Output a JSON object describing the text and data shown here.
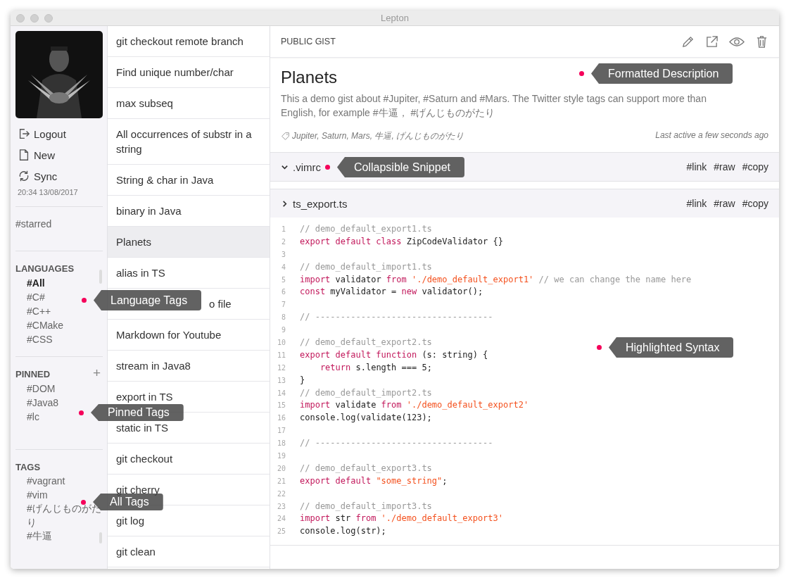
{
  "window": {
    "title": "Lepton"
  },
  "sidebar": {
    "actions": [
      {
        "kind": "logout",
        "label": "Logout"
      },
      {
        "kind": "new",
        "label": "New"
      },
      {
        "kind": "sync",
        "label": "Sync"
      }
    ],
    "sync_time": "20:34 13/08/2017",
    "starred": "#starred",
    "languages": {
      "heading": "LANGUAGES",
      "items": [
        {
          "label": "#All",
          "selected": true
        },
        {
          "label": "#C#",
          "selected": false
        },
        {
          "label": "#C++",
          "selected": false
        },
        {
          "label": "#CMake",
          "selected": false
        },
        {
          "label": "#CSS",
          "selected": false
        }
      ]
    },
    "pinned": {
      "heading": "PINNED",
      "add": "+",
      "items": [
        "#DOM",
        "#Java8",
        "#lc"
      ]
    },
    "tags": {
      "heading": "TAGS",
      "items": [
        "#vagrant",
        "#vim",
        "#げんじものがたり",
        "#牛逼"
      ]
    }
  },
  "gists": [
    {
      "title": "git checkout remote branch",
      "selected": false,
      "covered": false
    },
    {
      "title": "Find unique number/char",
      "selected": false,
      "covered": false
    },
    {
      "title": "max subseq",
      "selected": false,
      "covered": false
    },
    {
      "title": "All occurrences of substr in a string",
      "selected": false,
      "covered": false
    },
    {
      "title": "String & char in Java",
      "selected": false,
      "covered": false
    },
    {
      "title": "binary in Java",
      "selected": false,
      "covered": false
    },
    {
      "title": "Planets",
      "selected": true,
      "covered": false
    },
    {
      "title": "alias in TS",
      "selected": false,
      "covered": false
    },
    {
      "title": "o file",
      "selected": false,
      "covered": true
    },
    {
      "title": "Markdown for Youtube",
      "selected": false,
      "covered": false
    },
    {
      "title": "stream in Java8",
      "selected": false,
      "covered": false
    },
    {
      "title": "export in TS",
      "selected": false,
      "covered": false
    },
    {
      "title": "static in TS",
      "selected": false,
      "covered": false
    },
    {
      "title": "git checkout",
      "selected": false,
      "covered": false
    },
    {
      "title": "git cherry",
      "selected": false,
      "covered": false
    },
    {
      "title": "git log",
      "selected": false,
      "covered": false
    },
    {
      "title": "git clean",
      "selected": false,
      "covered": false
    }
  ],
  "detail": {
    "visibility": "PUBLIC GIST",
    "title": "Planets",
    "description": "This a demo gist about #Jupiter, #Saturn and #Mars. The Twitter style tags can support more than English, for example #牛逼，  #げんじものがたり",
    "tags": "Jupiter, Saturn, Mars, 牛逼, げんじものがたり",
    "last_active": "Last active a few seconds ago",
    "snippets": [
      {
        "name": ".vimrc",
        "expanded": true,
        "actions": [
          "#link",
          "#raw",
          "#copy"
        ]
      },
      {
        "name": "ts_export.ts",
        "expanded": false,
        "actions": [
          "#link",
          "#raw",
          "#copy"
        ],
        "code": [
          {
            "n": "1",
            "tokens": [
              {
                "kind": "comment",
                "text": "// demo_default_export1.ts"
              }
            ]
          },
          {
            "n": "2",
            "tokens": [
              {
                "kind": "keyword",
                "text": "export default class "
              },
              {
                "kind": "plain",
                "text": "ZipCodeValidator {}"
              }
            ]
          },
          {
            "n": "3"
          },
          {
            "n": "4",
            "tokens": [
              {
                "kind": "comment",
                "text": "// demo_default_import1.ts"
              }
            ]
          },
          {
            "n": "5",
            "tokens": [
              {
                "kind": "keyword",
                "text": "import "
              },
              {
                "kind": "plain",
                "text": "validator "
              },
              {
                "kind": "keyword",
                "text": "from "
              },
              {
                "kind": "string",
                "text": "'./demo_default_export1'"
              },
              {
                "kind": "comment",
                "text": " // we can change the name here"
              }
            ]
          },
          {
            "n": "6",
            "tokens": [
              {
                "kind": "keyword",
                "text": "const "
              },
              {
                "kind": "plain",
                "text": "myValidator = "
              },
              {
                "kind": "keyword",
                "text": "new "
              },
              {
                "kind": "plain",
                "text": "validator();"
              }
            ]
          },
          {
            "n": "7"
          },
          {
            "n": "8",
            "tokens": [
              {
                "kind": "comment",
                "text": "// -----------------------------------"
              }
            ]
          },
          {
            "n": "9"
          },
          {
            "n": "10",
            "tokens": [
              {
                "kind": "comment",
                "text": "// demo_default_export2.ts"
              }
            ]
          },
          {
            "n": "11",
            "tokens": [
              {
                "kind": "keyword",
                "text": "export default function "
              },
              {
                "kind": "plain",
                "text": "(s: string) {"
              }
            ]
          },
          {
            "n": "12",
            "tokens": [
              {
                "kind": "keyword",
                "text": "    return "
              },
              {
                "kind": "plain",
                "text": "s.length === 5;"
              }
            ]
          },
          {
            "n": "13",
            "tokens": [
              {
                "kind": "plain",
                "text": "}"
              }
            ]
          },
          {
            "n": "14",
            "tokens": [
              {
                "kind": "comment",
                "text": "// demo_default_import2.ts"
              }
            ]
          },
          {
            "n": "15",
            "tokens": [
              {
                "kind": "keyword",
                "text": "import "
              },
              {
                "kind": "plain",
                "text": "validate "
              },
              {
                "kind": "keyword",
                "text": "from "
              },
              {
                "kind": "string",
                "text": "'./demo_default_export2'"
              }
            ]
          },
          {
            "n": "16",
            "tokens": [
              {
                "kind": "plain",
                "text": "console.log(validate(123);"
              }
            ]
          },
          {
            "n": "17"
          },
          {
            "n": "18",
            "tokens": [
              {
                "kind": "comment",
                "text": "// -----------------------------------"
              }
            ]
          },
          {
            "n": "19"
          },
          {
            "n": "20",
            "tokens": [
              {
                "kind": "comment",
                "text": "// demo_default_export3.ts"
              }
            ]
          },
          {
            "n": "21",
            "tokens": [
              {
                "kind": "keyword",
                "text": "export default "
              },
              {
                "kind": "string",
                "text": "\"some_string\""
              },
              {
                "kind": "plain",
                "text": ";"
              }
            ]
          },
          {
            "n": "22"
          },
          {
            "n": "23",
            "tokens": [
              {
                "kind": "comment",
                "text": "// demo_default_import3.ts"
              }
            ]
          },
          {
            "n": "24",
            "tokens": [
              {
                "kind": "keyword",
                "text": "import "
              },
              {
                "kind": "plain",
                "text": "str "
              },
              {
                "kind": "keyword",
                "text": "from "
              },
              {
                "kind": "string",
                "text": "'./demo_default_export3'"
              }
            ]
          },
          {
            "n": "25",
            "tokens": [
              {
                "kind": "plain",
                "text": "console.log(str);"
              }
            ]
          }
        ]
      }
    ]
  },
  "callouts": [
    {
      "label": "Formatted Description",
      "kind": "description"
    },
    {
      "label": "Collapsible Snippet",
      "kind": "snippet"
    },
    {
      "label": "Language Tags",
      "kind": "languages"
    },
    {
      "label": "Pinned Tags",
      "kind": "pinned"
    },
    {
      "label": "All Tags",
      "kind": "tags"
    },
    {
      "label": "Highlighted Syntax",
      "kind": "syntax"
    }
  ]
}
